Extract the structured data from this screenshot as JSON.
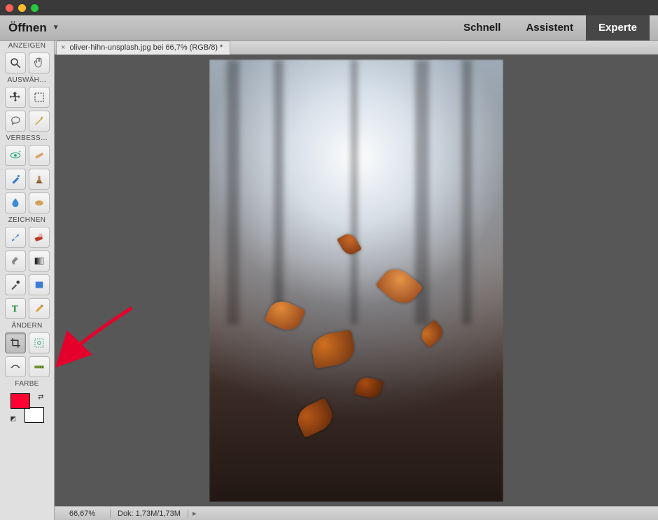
{
  "menubar": {
    "open_label": "Öffnen",
    "tabs": {
      "schnell": "Schnell",
      "assistent": "Assistent",
      "experte": "Experte"
    }
  },
  "toolbar": {
    "sections": {
      "anzeigen": "ANZEIGEN",
      "auswaehlen": "AUSWÄH…",
      "verbessern": "VERBESS…",
      "zeichnen": "ZEICHNEN",
      "aendern": "ÄNDERN",
      "farbe": "FARBE"
    },
    "tools": {
      "zoom": "zoom-icon",
      "hand": "hand-icon",
      "move": "move-icon",
      "marquee": "marquee-icon",
      "lasso": "lasso-icon",
      "magicwand": "magic-wand-icon",
      "redeye": "redeye-icon",
      "healing": "healing-icon",
      "clone": "clone-brush-icon",
      "stamp": "stamp-icon",
      "blur": "blur-icon",
      "sponge": "sponge-icon",
      "brush": "brush-icon",
      "eraser": "eraser-icon",
      "smudge": "smudge-icon",
      "gradient": "gradient-icon",
      "eyedropper": "eyedropper-icon",
      "shape": "shape-icon",
      "type": "type-icon",
      "pencil": "pencil-icon",
      "crop": "crop-icon",
      "recompose": "recompose-icon",
      "content": "content-move-icon",
      "straighten": "straighten-icon"
    },
    "colors": {
      "foreground": "#ff0033",
      "background": "#ffffff"
    }
  },
  "document": {
    "tab_title": "oliver-hihn-unsplash.jpg bei 66,7% (RGB/8) *"
  },
  "statusbar": {
    "zoom": "66,67%",
    "doc_label": "Dok: 1,73M/1,73M"
  }
}
